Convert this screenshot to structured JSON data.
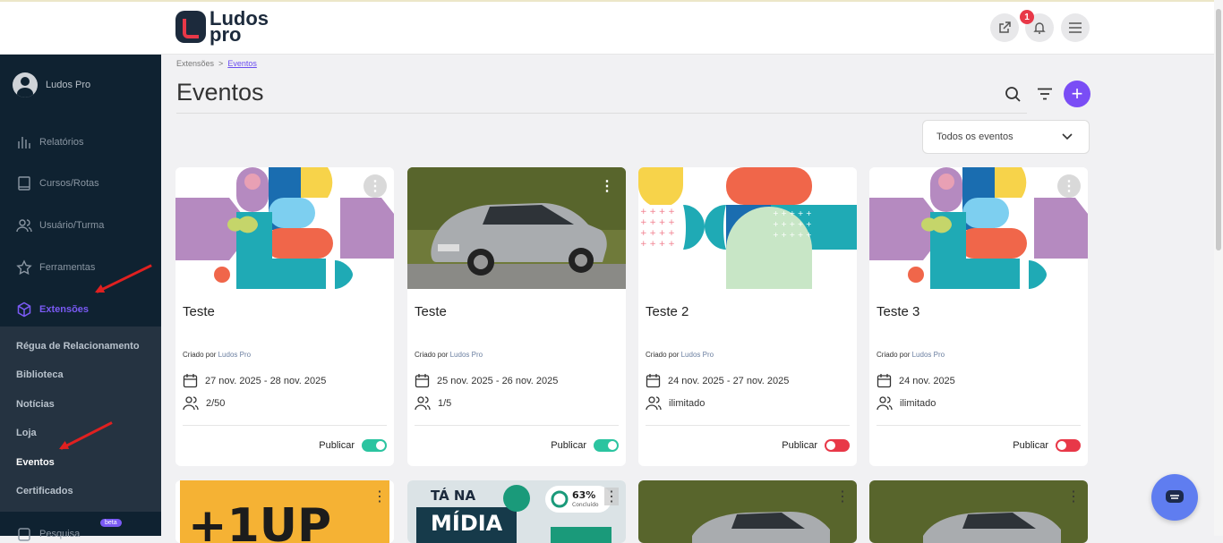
{
  "brand": {
    "line1": "Ludos",
    "line2": "pro"
  },
  "header": {
    "notifications_count": "1"
  },
  "sidebar": {
    "user_name": "Ludos Pro",
    "items": [
      {
        "label": "Relatórios",
        "icon": "chart-icon"
      },
      {
        "label": "Cursos/Rotas",
        "icon": "book-icon"
      },
      {
        "label": "Usuário/Turma",
        "icon": "users-icon"
      },
      {
        "label": "Ferramentas",
        "icon": "star-icon"
      },
      {
        "label": "Extensões",
        "icon": "cube-icon"
      }
    ],
    "subitems": [
      "Régua de Relacionamento",
      "Biblioteca",
      "Notícias",
      "Loja",
      "Eventos",
      "Certificados"
    ],
    "beta_label": "beta",
    "partial_item": "Pesquisa"
  },
  "breadcrumb": {
    "parent": "Extensões",
    "current": "Eventos"
  },
  "page": {
    "title": "Eventos"
  },
  "filter": {
    "selected": "Todos os eventos"
  },
  "cards": [
    {
      "title": "Teste",
      "created_by_label": "Criado por",
      "author": "Ludos Pro",
      "dates": "27 nov. 2025 - 28 nov. 2025",
      "capacity": "2/50",
      "publish_label": "Publicar",
      "published": true
    },
    {
      "title": "Teste",
      "created_by_label": "Criado por",
      "author": "Ludos Pro",
      "dates": "25 nov. 2025 - 26 nov. 2025",
      "capacity": "1/5",
      "publish_label": "Publicar",
      "published": true
    },
    {
      "title": "Teste 2",
      "created_by_label": "Criado por",
      "author": "Ludos Pro",
      "dates": "24 nov. 2025 - 27 nov. 2025",
      "capacity": "ilimitado",
      "publish_label": "Publicar",
      "published": false
    },
    {
      "title": "Teste 3",
      "created_by_label": "Criado por",
      "author": "Ludos Pro",
      "dates": "24 nov. 2025",
      "capacity": "ilimitado",
      "publish_label": "Publicar",
      "published": false
    }
  ],
  "row2": {
    "card1_text": "+1UP",
    "card2_text1": "TÁ NA",
    "card2_text2": "MÍDIA",
    "card2_percent": "63%",
    "card2_status": "Concluído"
  },
  "colors": {
    "accent": "#7a4df5",
    "sidebar": "#0f2231",
    "on": "#2bc4a0",
    "off": "#e83848"
  }
}
